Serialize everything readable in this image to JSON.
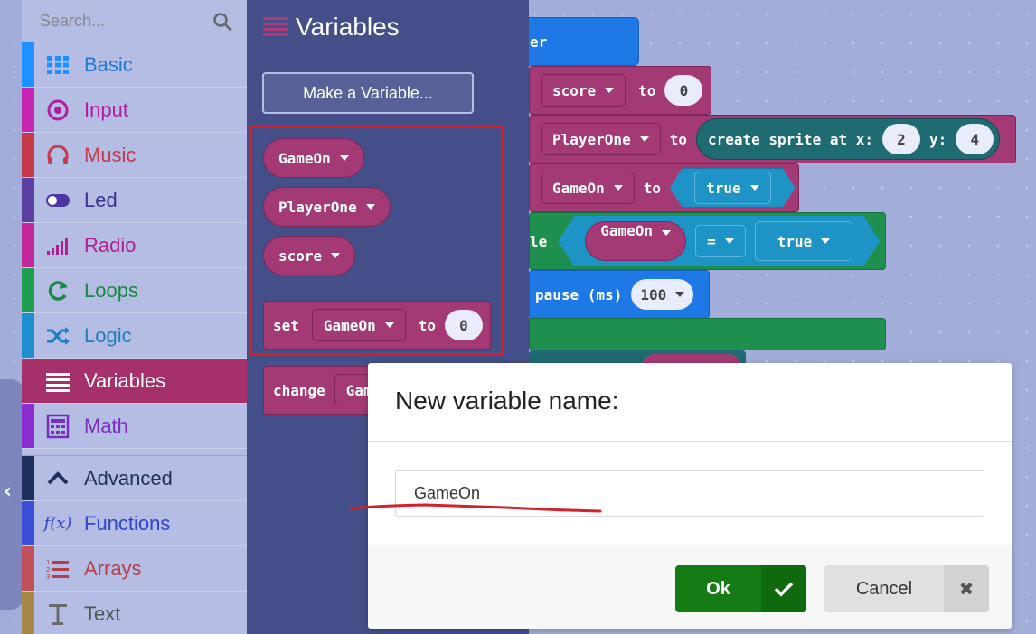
{
  "search": {
    "placeholder": "Search..."
  },
  "categories": [
    {
      "label": "Basic",
      "color": "#1e90ff",
      "icon": "grid-icon"
    },
    {
      "label": "Input",
      "color": "#c724b1",
      "icon": "radio-target-icon"
    },
    {
      "label": "Music",
      "color": "#e63022",
      "icon": "headphones-icon"
    },
    {
      "label": "Led",
      "color": "#5c2d91",
      "icon": "toggle-icon"
    },
    {
      "label": "Radio",
      "color": "#e3008c",
      "icon": "signal-bars-icon"
    },
    {
      "label": "Loops",
      "color": "#00aa00",
      "icon": "refresh-icon"
    },
    {
      "label": "Logic",
      "color": "#00a4a6",
      "icon": "shuffle-icon"
    },
    {
      "label": "Variables",
      "color": "#dc143c",
      "icon": "list-lines-icon"
    },
    {
      "label": "Math",
      "color": "#9400d3",
      "icon": "calculator-icon"
    },
    {
      "label": "Advanced",
      "color": "#3c3c3c",
      "icon": "chevron-up-icon"
    },
    {
      "label": "Functions",
      "color": "#3455db",
      "icon": "function-icon"
    },
    {
      "label": "Arrays",
      "color": "#e65722",
      "icon": "numbered-list-icon"
    },
    {
      "label": "Text",
      "color": "#b8860b",
      "icon": "text-icon"
    }
  ],
  "flyout": {
    "title": "Variables",
    "make_variable": "Make a Variable...",
    "variables": [
      "GameOn",
      "PlayerOne",
      "score"
    ],
    "set_block": {
      "keyword": "set",
      "var": "GameOn",
      "to": "to",
      "value": "0"
    },
    "change_block": {
      "keyword": "change",
      "var": "Gam"
    }
  },
  "workspace": {
    "hat_fragment": "er",
    "set_score": {
      "var": "score",
      "to": "to",
      "value": "0"
    },
    "set_player": {
      "var": "PlayerOne",
      "to": "to",
      "call": "create sprite at x:",
      "x": "2",
      "ylabel": "y:",
      "y": "4"
    },
    "set_gameon": {
      "var": "GameOn",
      "to": "to",
      "value": "true"
    },
    "while_block": {
      "fragment": "le",
      "var": "GameOn",
      "op": "=",
      "value": "true"
    },
    "pause_block": {
      "label": "pause (ms)",
      "value": "100"
    }
  },
  "dialog": {
    "title": "New variable name:",
    "input_value": "GameOn",
    "ok_label": "Ok",
    "cancel_label": "Cancel"
  }
}
